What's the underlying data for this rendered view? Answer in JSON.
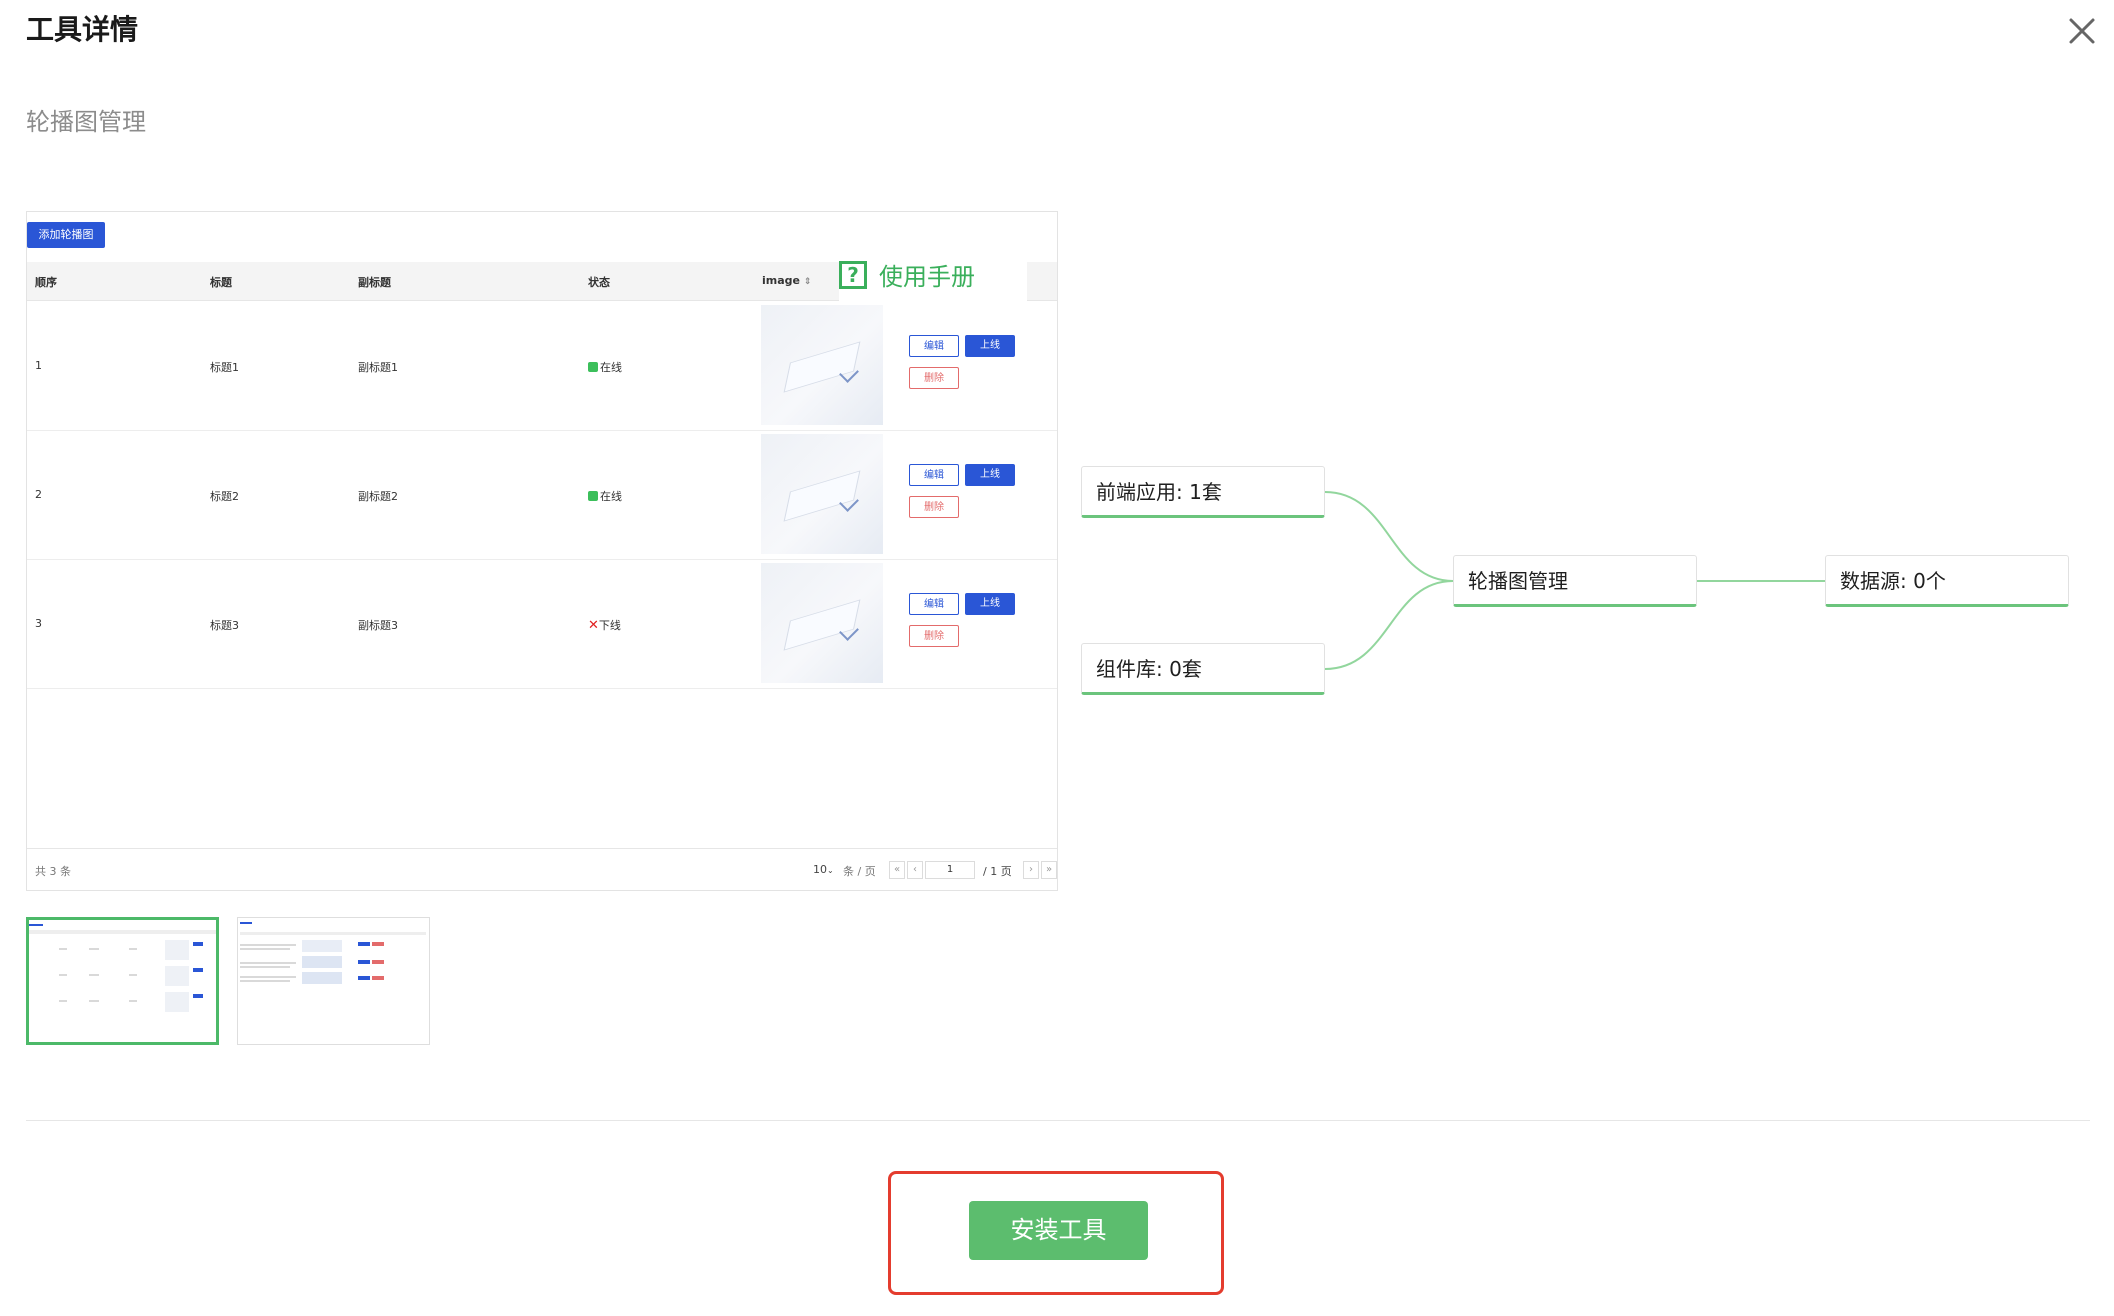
{
  "dialog": {
    "title": "工具详情",
    "tool_name": "轮播图管理"
  },
  "preview": {
    "add_button": "添加轮播图",
    "manual": "使用手册",
    "columns": [
      "顺序",
      "标题",
      "副标题",
      "状态",
      "image"
    ],
    "rows": [
      {
        "order": "1",
        "title": "标题1",
        "subtitle": "副标题1",
        "status": "在线",
        "status_on": true
      },
      {
        "order": "2",
        "title": "标题2",
        "subtitle": "副标题2",
        "status": "在线",
        "status_on": true
      },
      {
        "order": "3",
        "title": "标题3",
        "subtitle": "副标题3",
        "status": "下线",
        "status_on": false
      }
    ],
    "row_actions": {
      "edit": "编辑",
      "online": "上线",
      "delete": "删除"
    },
    "pager": {
      "total": "共 3 条",
      "page_size": "10",
      "page_size_unit": "条 / 页",
      "current_page": "1",
      "total_pages": "/ 1 页"
    }
  },
  "flow": {
    "frontend": "前端应用: 1套",
    "components": "组件库: 0套",
    "center": "轮播图管理",
    "datasource": "数据源: 0个",
    "link_color": "#92d69d"
  },
  "install": {
    "label": "安装工具"
  },
  "colors": {
    "accent_green": "#5cbd6e",
    "highlight_red": "#e43c2e",
    "table_blue": "#2a56d6"
  }
}
